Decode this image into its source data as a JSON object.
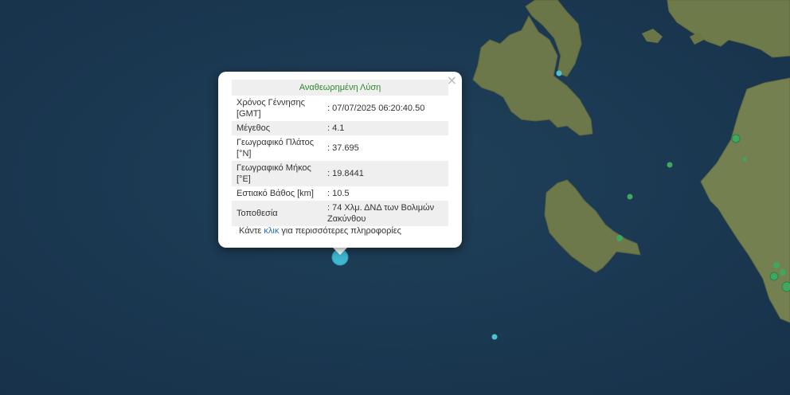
{
  "popup": {
    "title": "Αναθεωρημένη Λύση",
    "close_symbol": "×",
    "rows": [
      {
        "label": "Χρόνος Γέννησης [GMT]",
        "value": ": 07/07/2025 06:20:40.50"
      },
      {
        "label": "Μέγεθος",
        "value": ": 4.1"
      },
      {
        "label": "Γεωγραφικό Πλάτος [°N]",
        "value": ": 37.695"
      },
      {
        "label": "Γεωγραφικό Μήκος [°E]",
        "value": ": 19.8441"
      },
      {
        "label": "Εστιακό Βάθος [km]",
        "value": ": 10.5"
      },
      {
        "label": "Τοποθεσία",
        "value": ": 74 Χλμ. ΔΝΔ των Βολιμών Ζακύνθου"
      }
    ],
    "more_prefix": "Κάντε ",
    "more_link": "κλικ",
    "more_suffix": " για περισσότερες πληροφορίες"
  },
  "colors": {
    "sea": "#1d3a52",
    "land": "#6f7a4e",
    "selected_marker": "#3fb7cf",
    "marker_green": "#3fa760"
  },
  "markers": {
    "selected": {
      "lat": 37.695,
      "lon": 19.8441
    }
  }
}
